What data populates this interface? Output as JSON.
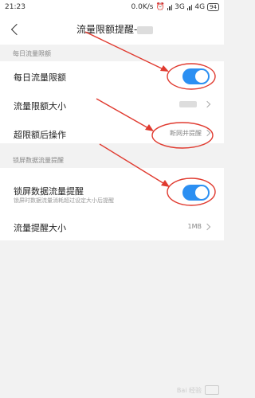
{
  "status_bar": {
    "time": "21:23",
    "speed": "0.0K/s",
    "network1": "3G",
    "network2": "4G",
    "battery": "94"
  },
  "header": {
    "title": "流量限额提醒-"
  },
  "sections": {
    "daily": "每日流量限额",
    "lockscreen": "锁屏数据流量提醒"
  },
  "rows": {
    "daily_limit": {
      "label": "每日流量限额",
      "enabled": true
    },
    "limit_size": {
      "label": "流量限额大小",
      "value": ""
    },
    "over_action": {
      "label": "超限额后操作",
      "value": "断网并提醒"
    },
    "lock_reminder": {
      "label": "锁屏数据流量提醒",
      "sub": "锁屏时数据流量消耗超过设定大小后提醒",
      "enabled": true
    },
    "reminder_size": {
      "label": "流量提醒大小",
      "value": "1MB"
    }
  },
  "colors": {
    "accent": "#2b8ff2",
    "annotation": "#e03a2f"
  },
  "watermark": "Bai 经验"
}
